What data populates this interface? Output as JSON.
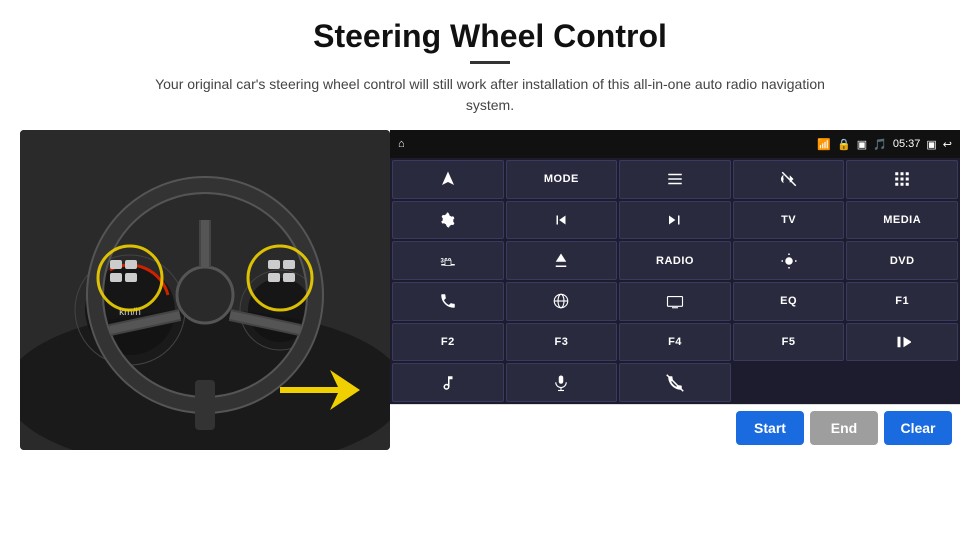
{
  "page": {
    "title": "Steering Wheel Control",
    "subtitle": "Your original car's steering wheel control will still work after installation of this all-in-one auto radio navigation system."
  },
  "status_bar": {
    "time": "05:37",
    "home_icon": "⌂"
  },
  "buttons": [
    {
      "id": "btn-navigate",
      "label": "",
      "icon": "navigate"
    },
    {
      "id": "btn-mode",
      "label": "MODE",
      "icon": ""
    },
    {
      "id": "btn-list",
      "label": "",
      "icon": "list"
    },
    {
      "id": "btn-mute",
      "label": "",
      "icon": "mute"
    },
    {
      "id": "btn-apps",
      "label": "",
      "icon": "apps"
    },
    {
      "id": "btn-settings",
      "label": "",
      "icon": "settings"
    },
    {
      "id": "btn-prev",
      "label": "",
      "icon": "prev"
    },
    {
      "id": "btn-next",
      "label": "",
      "icon": "next"
    },
    {
      "id": "btn-tv",
      "label": "TV",
      "icon": ""
    },
    {
      "id": "btn-media",
      "label": "MEDIA",
      "icon": ""
    },
    {
      "id": "btn-360",
      "label": "",
      "icon": "360"
    },
    {
      "id": "btn-eject",
      "label": "",
      "icon": "eject"
    },
    {
      "id": "btn-radio",
      "label": "RADIO",
      "icon": ""
    },
    {
      "id": "btn-brightness",
      "label": "",
      "icon": "brightness"
    },
    {
      "id": "btn-dvd",
      "label": "DVD",
      "icon": ""
    },
    {
      "id": "btn-phone",
      "label": "",
      "icon": "phone"
    },
    {
      "id": "btn-browser",
      "label": "",
      "icon": "browser"
    },
    {
      "id": "btn-screen",
      "label": "",
      "icon": "screen"
    },
    {
      "id": "btn-eq",
      "label": "EQ",
      "icon": ""
    },
    {
      "id": "btn-f1",
      "label": "F1",
      "icon": ""
    },
    {
      "id": "btn-f2",
      "label": "F2",
      "icon": ""
    },
    {
      "id": "btn-f3",
      "label": "F3",
      "icon": ""
    },
    {
      "id": "btn-f4",
      "label": "F4",
      "icon": ""
    },
    {
      "id": "btn-f5",
      "label": "F5",
      "icon": ""
    },
    {
      "id": "btn-playpause",
      "label": "",
      "icon": "playpause"
    },
    {
      "id": "btn-music",
      "label": "",
      "icon": "music"
    },
    {
      "id": "btn-mic",
      "label": "",
      "icon": "mic"
    },
    {
      "id": "btn-call",
      "label": "",
      "icon": "call"
    }
  ],
  "bottom_bar": {
    "start_label": "Start",
    "end_label": "End",
    "clear_label": "Clear"
  }
}
